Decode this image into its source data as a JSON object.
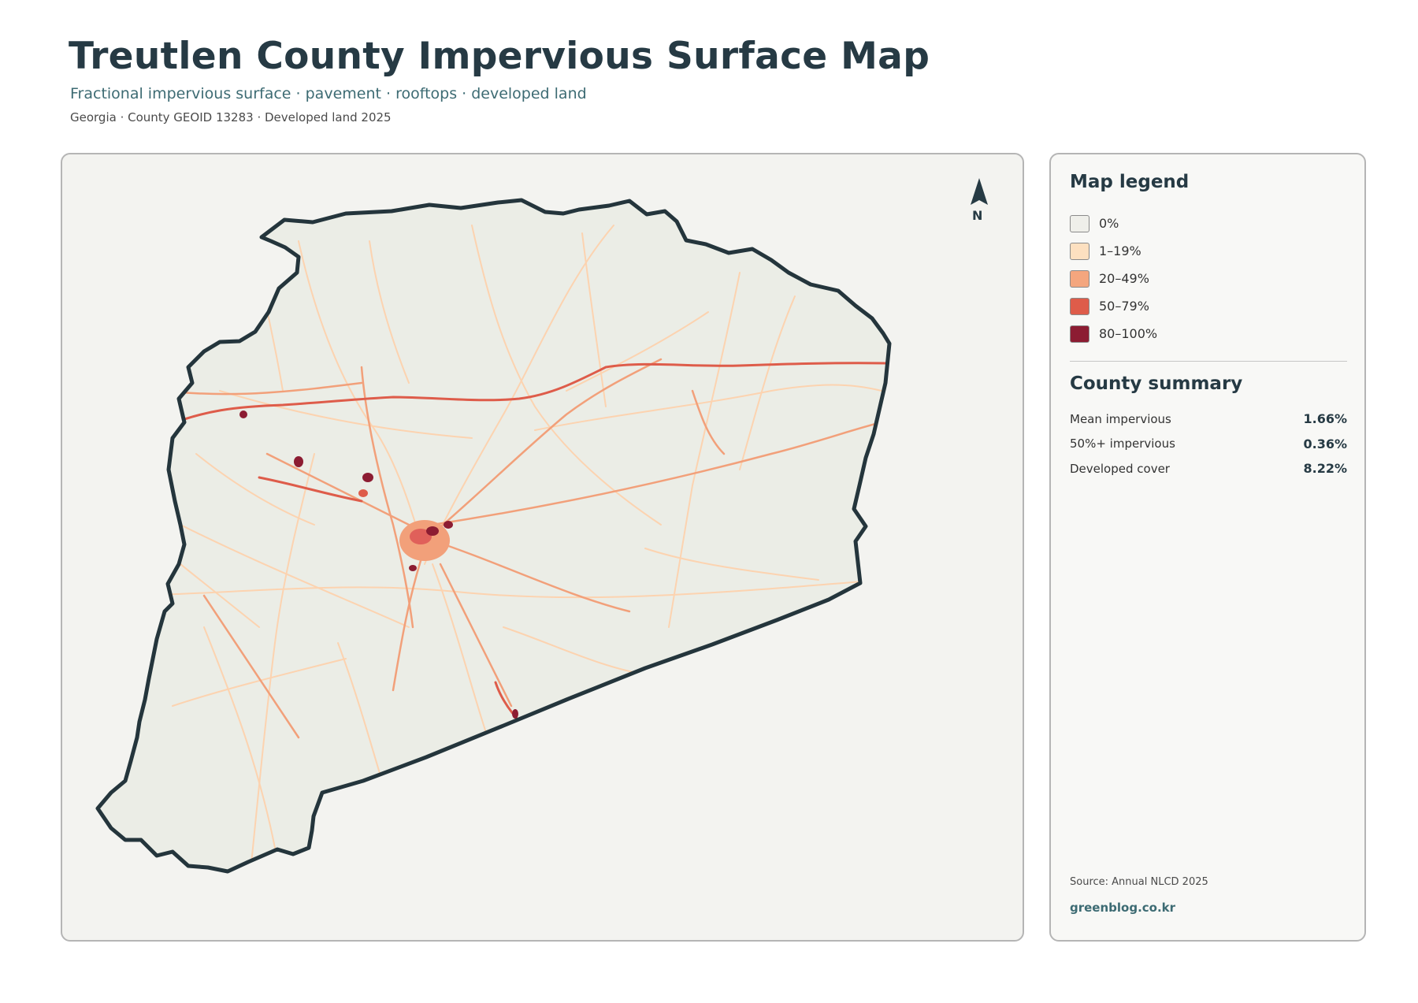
{
  "header": {
    "title": "Treutlen County Impervious Surface Map",
    "subtitle": "Fractional impervious surface · pavement · rooftops · developed land",
    "meta": "Georgia · County GEOID 13283 · Developed land 2025"
  },
  "map": {
    "north_label": "N",
    "county_fill": "#ebede6",
    "boundary_color": "#24353c"
  },
  "legend": {
    "title": "Map legend",
    "items": [
      {
        "label": "0%",
        "color": "#efefea"
      },
      {
        "label": "1–19%",
        "color": "#fde0c0"
      },
      {
        "label": "20–49%",
        "color": "#f4a67e"
      },
      {
        "label": "50–79%",
        "color": "#de5c4a"
      },
      {
        "label": "80–100%",
        "color": "#8c1c32"
      }
    ]
  },
  "summary": {
    "title": "County summary",
    "rows": [
      {
        "label": "Mean impervious",
        "value": "1.66%"
      },
      {
        "label": "50%+ impervious",
        "value": "0.36%"
      },
      {
        "label": "Developed cover",
        "value": "8.22%"
      }
    ]
  },
  "footer": {
    "source": "Source: Annual NLCD 2025",
    "credit": "greenblog.co.kr"
  }
}
